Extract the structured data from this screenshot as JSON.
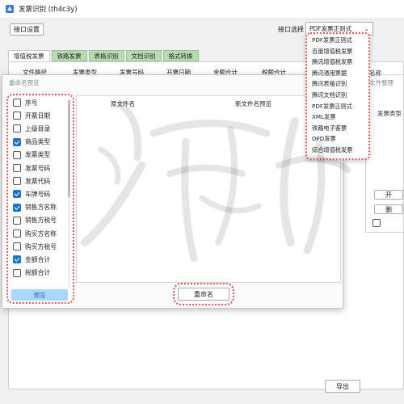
{
  "window": {
    "title": "发票识别 (th4c3y)"
  },
  "toolbar": {
    "api_settings_label": "接口设置",
    "api_select_label": "接口选择",
    "api_selected_value": "PDF发票正则式"
  },
  "tabs": [
    {
      "label": "增值税发票"
    },
    {
      "label": "铁路发票"
    },
    {
      "label": "表格识别"
    },
    {
      "label": "文档识别"
    },
    {
      "label": "格式转换"
    }
  ],
  "table_headers": [
    "文件路径",
    "发票类型",
    "发票号码",
    "开票日期",
    "金额合计",
    "税额合计"
  ],
  "dialog": {
    "title": "重命名预览",
    "columns": [
      "原文件名",
      "新文件名预览"
    ],
    "preview_label": "预览",
    "rename_label": "重命名"
  },
  "fields": [
    {
      "label": "序号",
      "checked": false
    },
    {
      "label": "开票日期",
      "checked": false
    },
    {
      "label": "上级目录",
      "checked": false
    },
    {
      "label": "商品类型",
      "checked": true
    },
    {
      "label": "发票类型",
      "checked": false
    },
    {
      "label": "发票号码",
      "checked": false
    },
    {
      "label": "发票代码",
      "checked": false
    },
    {
      "label": "车牌号码",
      "checked": true
    },
    {
      "label": "销售方名称",
      "checked": true
    },
    {
      "label": "销售方税号",
      "checked": false
    },
    {
      "label": "购买方名称",
      "checked": false
    },
    {
      "label": "购买方税号",
      "checked": false
    },
    {
      "label": "金额合计",
      "checked": true
    },
    {
      "label": "税额合计",
      "checked": false
    }
  ],
  "api_options": [
    "PDF发票正则式",
    "百度增值税发票",
    "腾讯增值税发票",
    "腾讯通用票据",
    "腾讯表格识别",
    "腾讯文档识别",
    "PDF发票正则式",
    "XML发票",
    "铁路电子客票",
    "OFD发票",
    "综合增值税发票"
  ],
  "right_panel": {
    "col_label": "名称",
    "panel_label": "文件整理",
    "invoice_type_label": "发票类型",
    "open_label": "开",
    "delete_label": "删"
  },
  "footer": {
    "export_label": "导出"
  },
  "colors": {
    "highlight_ring": "#e05555",
    "checkbox_checked": "#1a73c8",
    "tab_green": "#b8dcb0"
  }
}
